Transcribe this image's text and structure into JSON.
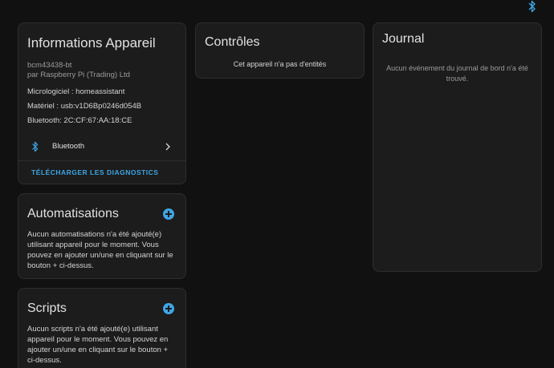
{
  "colors": {
    "accent": "#3ea6e6",
    "background": "#111111",
    "card": "#1c1c1c"
  },
  "header": {
    "icon": "bluetooth-icon"
  },
  "info": {
    "title": "Informations Appareil",
    "model": "bcm43438-bt",
    "manufacturer": "par Raspberry Pi (Trading) Ltd",
    "firmware": "Micrologiciel : homeassistant",
    "hardware": "Matériel : usb:v1D6Bp0246d054B",
    "bluetooth_address": "Bluetooth: 2C:CF:67:AA:18:CE",
    "integration_label": "Bluetooth",
    "diagnostics_label": "TÉLÉCHARGER LES DIAGNOSTICS"
  },
  "automations": {
    "title": "Automatisations",
    "description": "Aucun automatisations n'a été ajouté(e) utilisant appareil pour le moment. Vous pouvez en ajouter un/une en cliquant sur le bouton + ci-dessus."
  },
  "scripts": {
    "title": "Scripts",
    "description": "Aucun scripts n'a été ajouté(e) utilisant appareil pour le moment. Vous pouvez en ajouter un/une en cliquant sur le bouton + ci-dessus."
  },
  "controls": {
    "title": "Contrôles",
    "empty": "Cet appareil n'a pas d'entités"
  },
  "journal": {
    "title": "Journal",
    "empty": "Aucun événement du journal de bord n'a été trouvé."
  }
}
